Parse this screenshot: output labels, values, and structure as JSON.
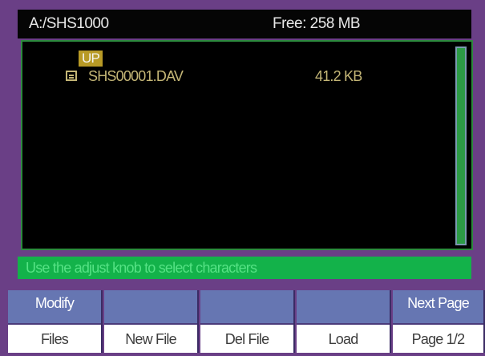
{
  "header": {
    "path": "A:/SHS1000",
    "free_space": "Free: 258 MB"
  },
  "file_list": {
    "up_label": "UP",
    "files": [
      {
        "icon": "file-icon",
        "name": "SHS00001.DAV",
        "size": "41.2 KB"
      }
    ]
  },
  "status": {
    "message": "Use the adjust knob to select characters"
  },
  "soft_keys": [
    {
      "top": "Modify",
      "bottom": "Files"
    },
    {
      "top": "",
      "bottom": "New File"
    },
    {
      "top": "",
      "bottom": "Del File"
    },
    {
      "top": "",
      "bottom": "Load"
    },
    {
      "top": "Next Page",
      "bottom": "Page 1/2"
    }
  ],
  "colors": {
    "bezel": "#6a3f86",
    "panel_bg": "#000000",
    "status_green": "#13b24a",
    "file_text": "#c4b676",
    "highlight": "#b89a26",
    "softkey_blue": "#6676b2"
  }
}
